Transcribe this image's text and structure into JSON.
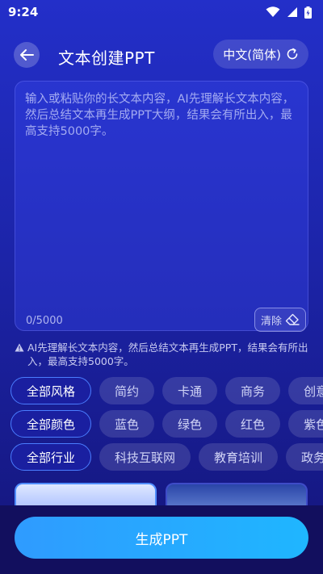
{
  "status_bar": {
    "time": "9:24",
    "icons": [
      "wifi-icon",
      "signal-icon",
      "battery-icon"
    ]
  },
  "header": {
    "title": "文本创建PPT",
    "language_label": "中文(简体)"
  },
  "editor": {
    "placeholder": "输入或粘贴你的长文本内容，AI先理解长文本内容，然后总结文本再生成PPT大纲，结果会有所出入，最高支持5000字。",
    "value": "",
    "char_count": "0/5000",
    "clear_label": "清除"
  },
  "notice": {
    "text": "AI先理解长文本内容，然后总结文本再生成PPT，结果会有所出入，最高支持5000字。"
  },
  "filters": {
    "style": [
      "全部风格",
      "简约",
      "卡通",
      "商务",
      "创意"
    ],
    "color": [
      "全部颜色",
      "蓝色",
      "绿色",
      "红色",
      "紫色"
    ],
    "industry": [
      "全部行业",
      "科技互联网",
      "教育培训",
      "政务"
    ]
  },
  "generate_button": "生成PPT",
  "colors": {
    "accent": "#1fb6ff",
    "active_chip_border": "#4a7dff",
    "background_top": "#232fc9",
    "background_bottom": "#14157a"
  }
}
